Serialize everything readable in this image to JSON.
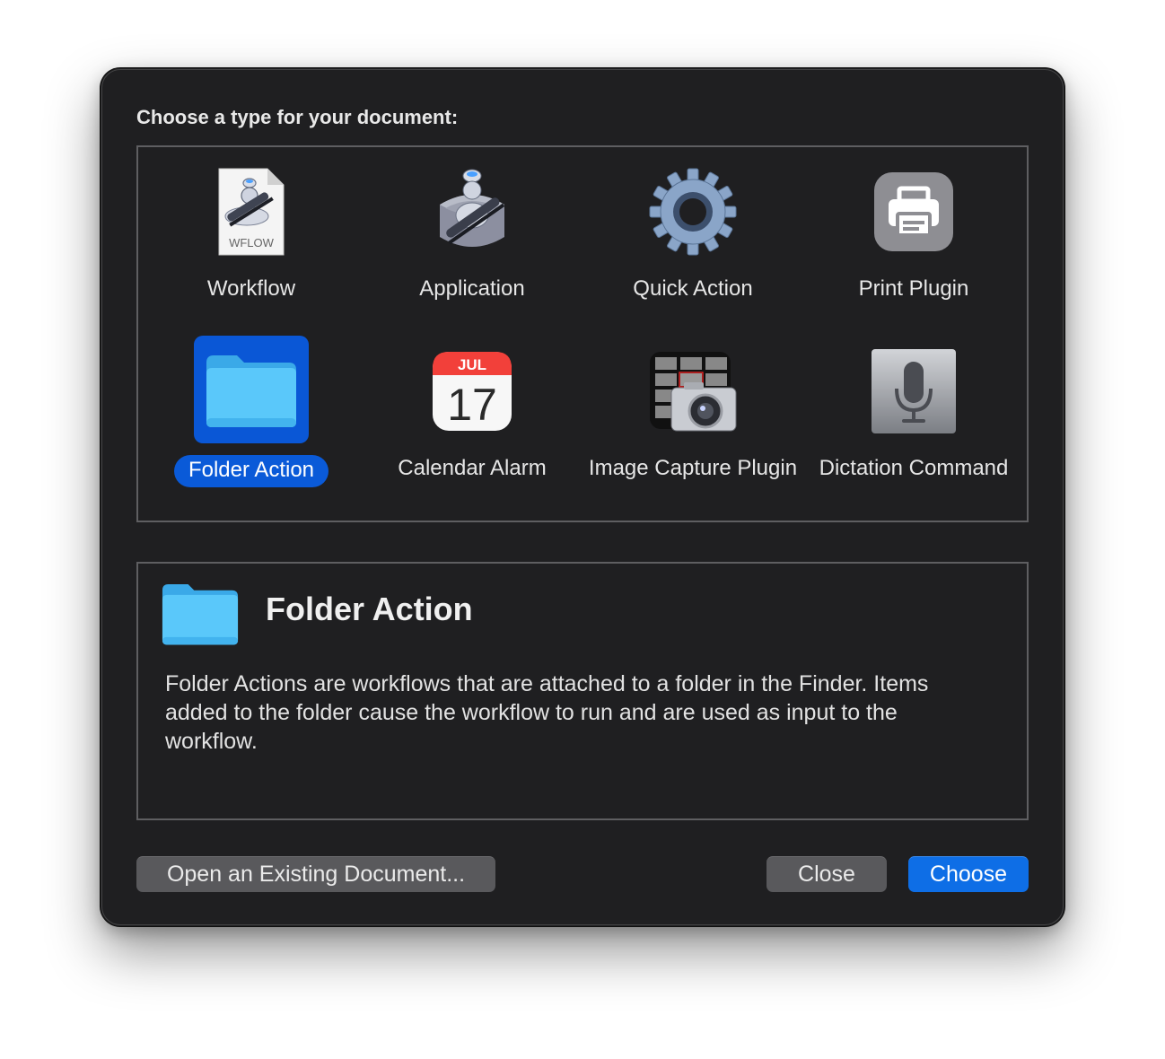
{
  "dialog": {
    "prompt": "Choose a type for your document:"
  },
  "types": [
    {
      "label": "Workflow",
      "icon": "workflow-document-icon",
      "badge": "WFLOW"
    },
    {
      "label": "Application",
      "icon": "automator-application-icon"
    },
    {
      "label": "Quick Action",
      "icon": "gear-icon"
    },
    {
      "label": "Print Plugin",
      "icon": "printer-icon"
    },
    {
      "label": "Folder Action",
      "icon": "folder-icon",
      "selected": true
    },
    {
      "label": "Calendar Alarm",
      "icon": "calendar-icon",
      "month": "JUL",
      "day": "17"
    },
    {
      "label": "Image Capture Plugin",
      "icon": "image-capture-icon"
    },
    {
      "label": "Dictation Command",
      "icon": "microphone-icon"
    }
  ],
  "description": {
    "title": "Folder Action",
    "text": "Folder Actions are workflows that are attached to a folder in the Finder. Items added to the folder cause the workflow to run and are used as input to the workflow."
  },
  "buttons": {
    "open_existing": "Open an Existing Document...",
    "close": "Close",
    "choose": "Choose"
  },
  "colors": {
    "background": "#1f1f21",
    "accent": "#0e6ee6",
    "selection": "#0a57d6",
    "folder": "#5ac8fa"
  }
}
